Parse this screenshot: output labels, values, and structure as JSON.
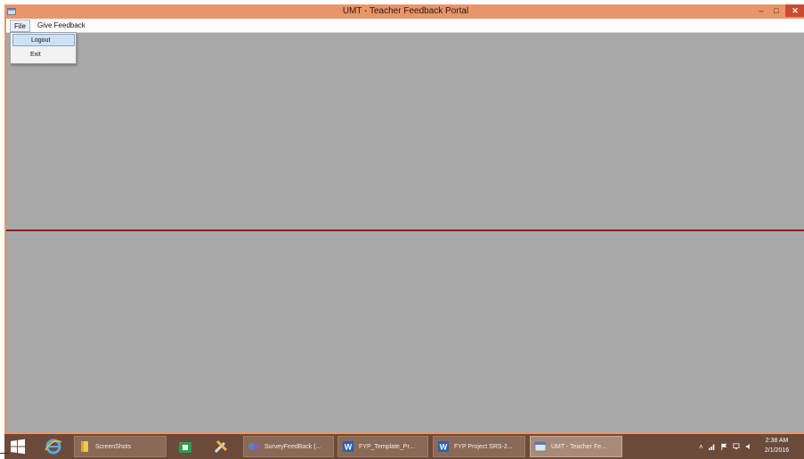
{
  "window": {
    "title": "UMT - Teacher Feedback Portal",
    "controls": {
      "minimize": "–",
      "maximize": "□",
      "close": "✕"
    }
  },
  "menubar": {
    "file": "File",
    "give_feedback": "Give Feedback"
  },
  "file_menu": {
    "items": [
      "Logout",
      "Exit"
    ],
    "highlighted": "Logout"
  },
  "taskbar": {
    "buttons": [
      {
        "label": "ScreenShots",
        "icon": "folder-icon"
      },
      {
        "label": "SurveyFeedBack (...",
        "icon": "visual-studio-icon"
      },
      {
        "label": "FYP_Template_Pr...",
        "icon": "word-icon"
      },
      {
        "label": "FYP Project SRS-2...",
        "icon": "word-icon"
      },
      {
        "label": "UMT - Teacher Fe...",
        "icon": "app-window-icon",
        "active": true
      }
    ],
    "tray_arrow": "˄",
    "clock_time": "2:38 AM",
    "clock_date": "2/1/2016"
  },
  "colors": {
    "titlebar": "#e8956a",
    "client": "#a8a8a8",
    "divider": "#8b1d1d",
    "taskbar": "#6b4a3a",
    "close": "#c84b31"
  }
}
